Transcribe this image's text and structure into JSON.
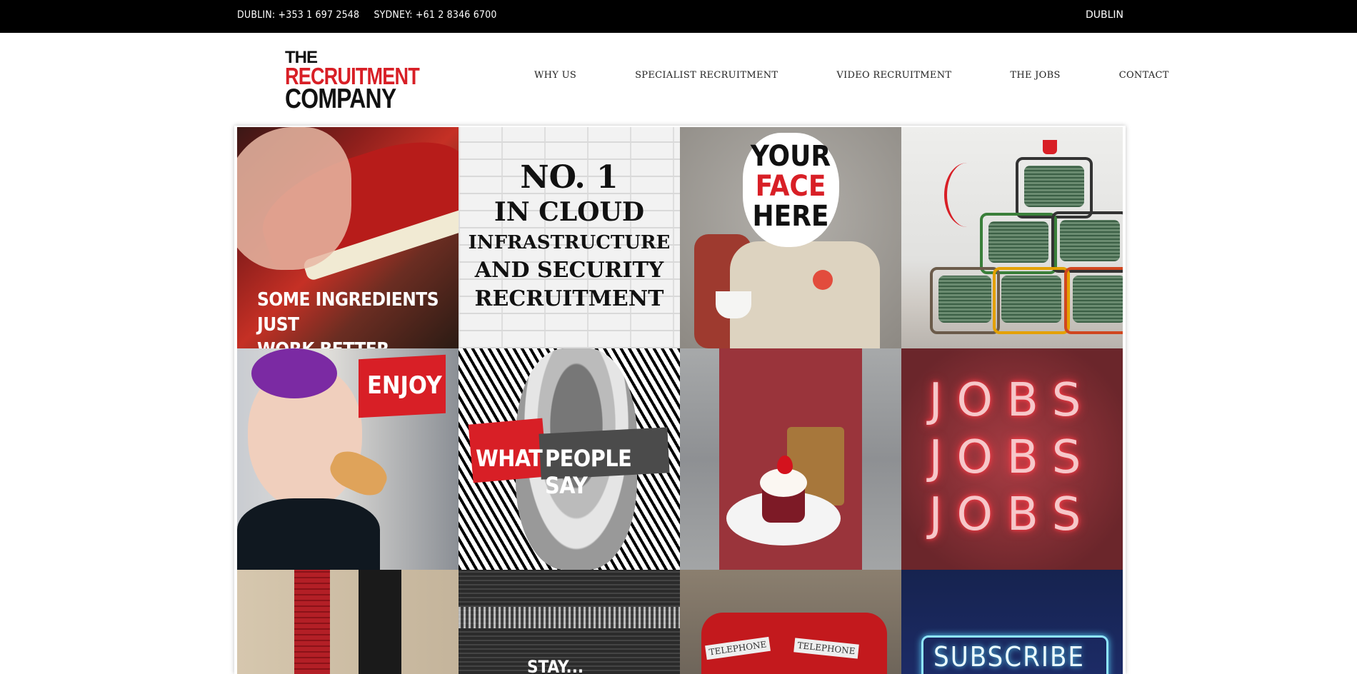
{
  "topbar": {
    "dublin_phone": "DUBLIN: +353 1 697 2548",
    "sydney_phone": "SYDNEY: +61 2 8346 6700",
    "region": "DUBLIN"
  },
  "logo": {
    "line1": "THE",
    "line2": "RECRUITMENT",
    "line3": "COMPANY"
  },
  "nav": {
    "items": [
      {
        "label": "WHY US"
      },
      {
        "label": "SPECIALIST RECRUITMENT"
      },
      {
        "label": "VIDEO RECRUITMENT"
      },
      {
        "label": "THE JOBS"
      },
      {
        "label": "CONTACT"
      }
    ]
  },
  "tiles": {
    "t1": {
      "line1": "SOME INGREDIENTS JUST",
      "line2": "WORK BETTER TOGETHER..."
    },
    "t2": {
      "line1": "NO. 1",
      "line2": "IN CLOUD",
      "line3": "INFRASTRUCTURE",
      "line4": "AND SECURITY",
      "line5": "RECRUITMENT"
    },
    "t3": {
      "line1": "YOUR",
      "line2": "FACE",
      "line3": "HERE"
    },
    "t5": {
      "label": "ENJOY"
    },
    "t6": {
      "word1": "WHAT",
      "word2": "PEOPLE SAY"
    },
    "t8": {
      "line1": "JOBS",
      "line2": "JOBS",
      "line3": "JOBS"
    },
    "t10": {
      "label": "STAY..."
    },
    "t11": {
      "sign1": "TELEPHONE",
      "sign2": "TELEPHONE"
    },
    "t12": {
      "label": "SUBSCRIBE"
    }
  },
  "colors": {
    "brand_red": "#d81f26",
    "topbar_bg": "#000000",
    "text_dark": "#111111"
  }
}
